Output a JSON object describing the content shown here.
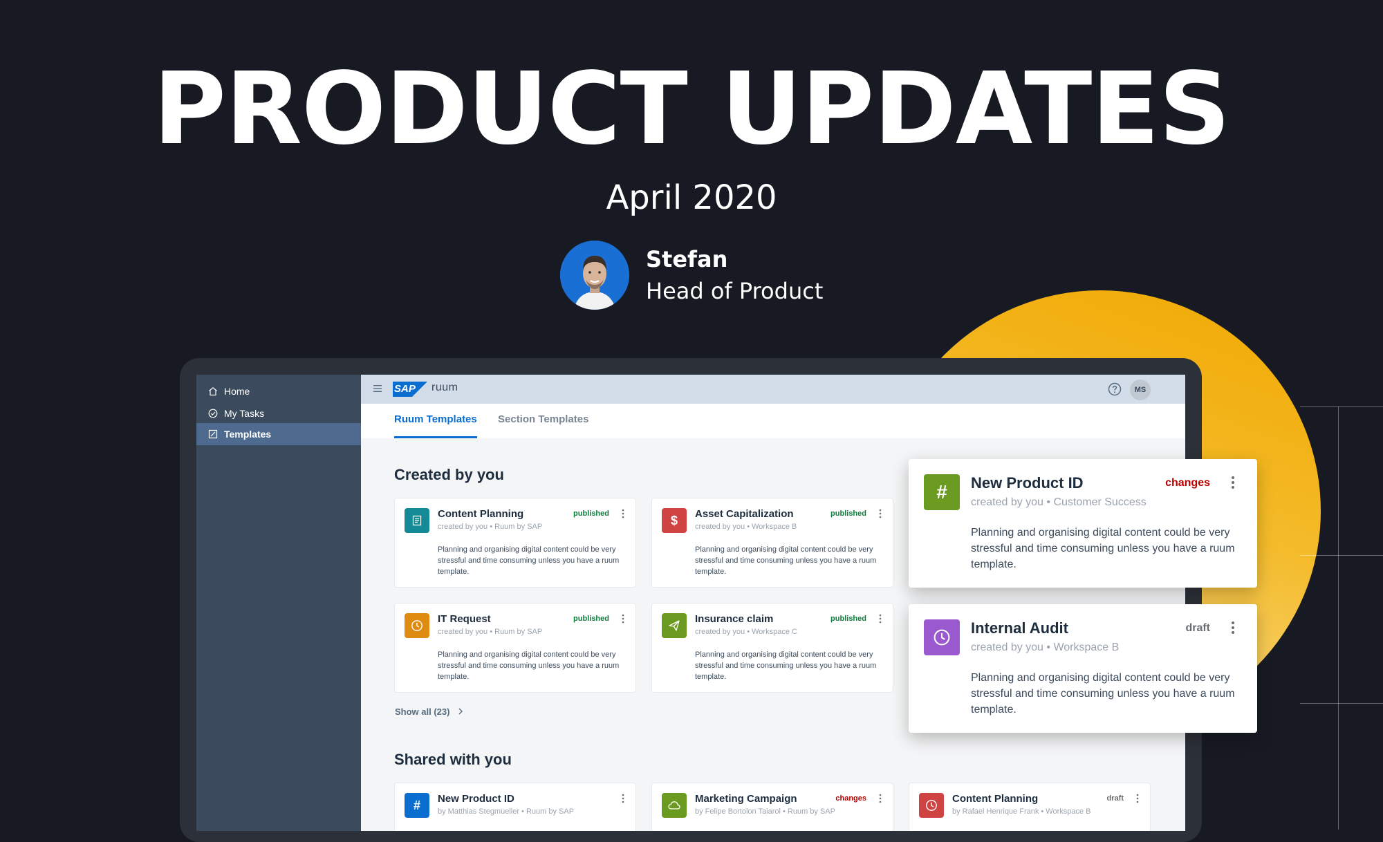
{
  "hero": {
    "title": "PRODUCT UPDATES",
    "date": "April 2020",
    "author_name": "Stefan",
    "author_role": "Head of Product"
  },
  "sidebar": {
    "items": [
      {
        "label": "Home",
        "icon": "home-icon"
      },
      {
        "label": "My Tasks",
        "icon": "check-circle-icon"
      },
      {
        "label": "Templates",
        "icon": "template-icon",
        "active": true
      }
    ]
  },
  "topbar": {
    "logo": "SAP",
    "product": "ruum",
    "user_initials": "MS"
  },
  "tabs": [
    {
      "label": "Ruum Templates",
      "active": true
    },
    {
      "label": "Section Templates",
      "active": false
    }
  ],
  "created": {
    "title": "Created by you",
    "show_all": "Show all (23)",
    "cards": [
      {
        "title": "Content Planning",
        "meta": "created by you • Ruum by SAP",
        "status": "published",
        "color": "#138a96",
        "icon": "document-icon",
        "desc": "Planning and organising digital content could be very stressful and time consuming unless you have a ruum template."
      },
      {
        "title": "Asset Capitalization",
        "meta": "created by you • Workspace B",
        "status": "published",
        "color": "#d04343",
        "icon": "dollar-icon",
        "desc": "Planning and organising digital content could be very stressful and time consuming unless you have a ruum template."
      },
      {
        "title": "IT Request",
        "meta": "created by you • Ruum by SAP",
        "status": "published",
        "color": "#df8a10",
        "icon": "clock-icon",
        "desc": "Planning and organising digital content could be very stressful and time consuming unless you have a ruum template."
      },
      {
        "title": "Insurance claim",
        "meta": "created by you • Workspace C",
        "status": "published",
        "color": "#6a9a1f",
        "icon": "paper-plane-icon",
        "desc": "Planning and organising digital content could be very stressful and time consuming unless you have a ruum template."
      }
    ]
  },
  "floating": [
    {
      "title": "New Product ID",
      "meta": "created by you • Customer Success",
      "status": "changes",
      "color": "#6a9a1f",
      "icon": "hash-icon",
      "desc": "Planning and organising digital content could be very stressful and time consuming unless you have a ruum template."
    },
    {
      "title": "Internal Audit",
      "meta": "created by you • Workspace B",
      "status": "draft",
      "color": "#9b59d0",
      "icon": "clock-icon",
      "desc": "Planning and organising digital content could be very stressful and time consuming unless you have a ruum template."
    }
  ],
  "shared": {
    "title": "Shared with you",
    "cards": [
      {
        "title": "New Product ID",
        "meta": "by Matthias Stegmueller • Ruum by SAP",
        "status": "",
        "color": "#0a6ed1",
        "icon": "hash-icon"
      },
      {
        "title": "Marketing Campaign",
        "meta": "by Felipe Bortolon Taiarol • Ruum by SAP",
        "status": "changes",
        "color": "#6a9a1f",
        "icon": "cloud-icon"
      },
      {
        "title": "Content Planning",
        "meta": "by Rafael Henrique Frank • Workspace B",
        "status": "draft",
        "color": "#d04343",
        "icon": "clock-icon"
      }
    ]
  }
}
